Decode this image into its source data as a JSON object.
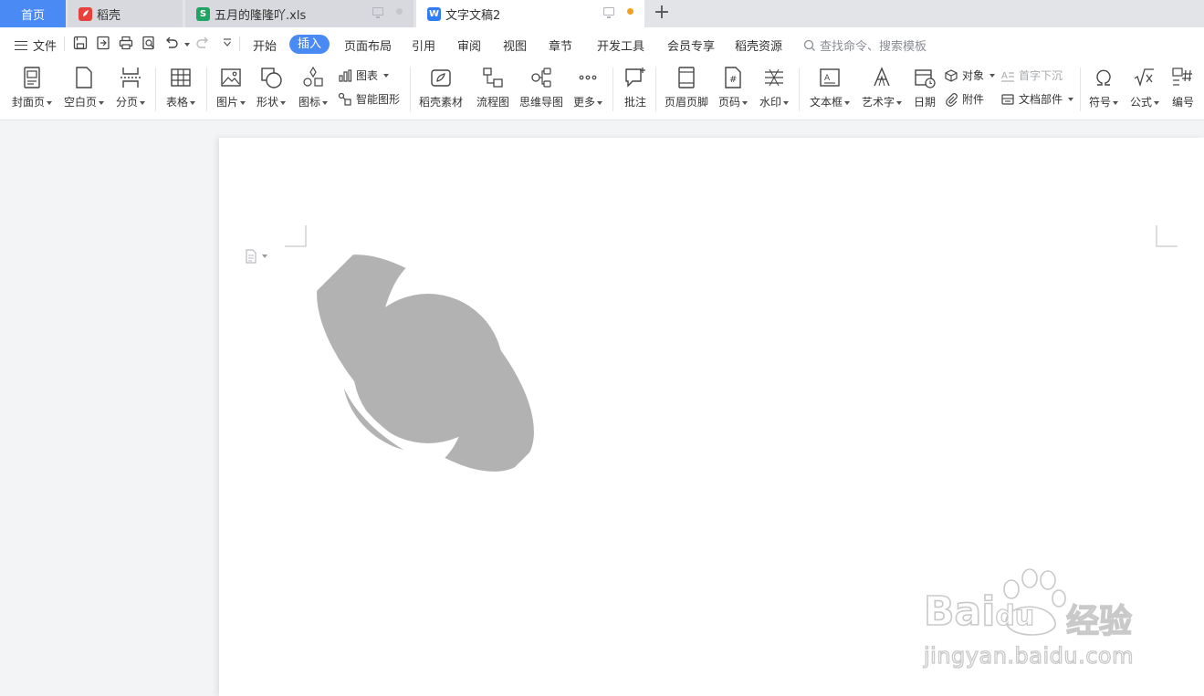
{
  "tabs": [
    {
      "label": "首页"
    },
    {
      "label": "稻壳"
    },
    {
      "label": "五月的隆隆吖.xls"
    },
    {
      "label": "文字文稿2"
    }
  ],
  "menu": {
    "file": "文件",
    "items": [
      "开始",
      "插入",
      "页面布局",
      "引用",
      "审阅",
      "视图",
      "章节",
      "开发工具",
      "会员专享",
      "稻壳资源"
    ],
    "active": "插入",
    "search_placeholder": "查找命令、搜索模板"
  },
  "ribbon": {
    "cover": "封面页",
    "blank": "空白页",
    "pagebreak": "分页",
    "table": "表格",
    "picture": "图片",
    "shape": "形状",
    "iconlib": "图标",
    "chart": "图表",
    "smartart": "智能图形",
    "docer": "稻壳素材",
    "flow": "流程图",
    "mind": "思维导图",
    "more": "更多",
    "comment": "批注",
    "header": "页眉页脚",
    "pagenum": "页码",
    "watermark": "水印",
    "textbox": "文本框",
    "wordart": "艺术字",
    "date": "日期",
    "object": "对象",
    "attach": "附件",
    "dropcap": "首字下沉",
    "docpart": "文档部件",
    "symbol": "符号",
    "formula": "公式",
    "numbering": "编号"
  },
  "watermark": {
    "brand": "Bai",
    "brand2": "du",
    "cn": "经验",
    "url": "jingyan.baidu.com"
  },
  "colors": {
    "accent": "#4a8af4",
    "saturn": "#b2b2b2",
    "unsaved_dot": "#f0a020"
  }
}
